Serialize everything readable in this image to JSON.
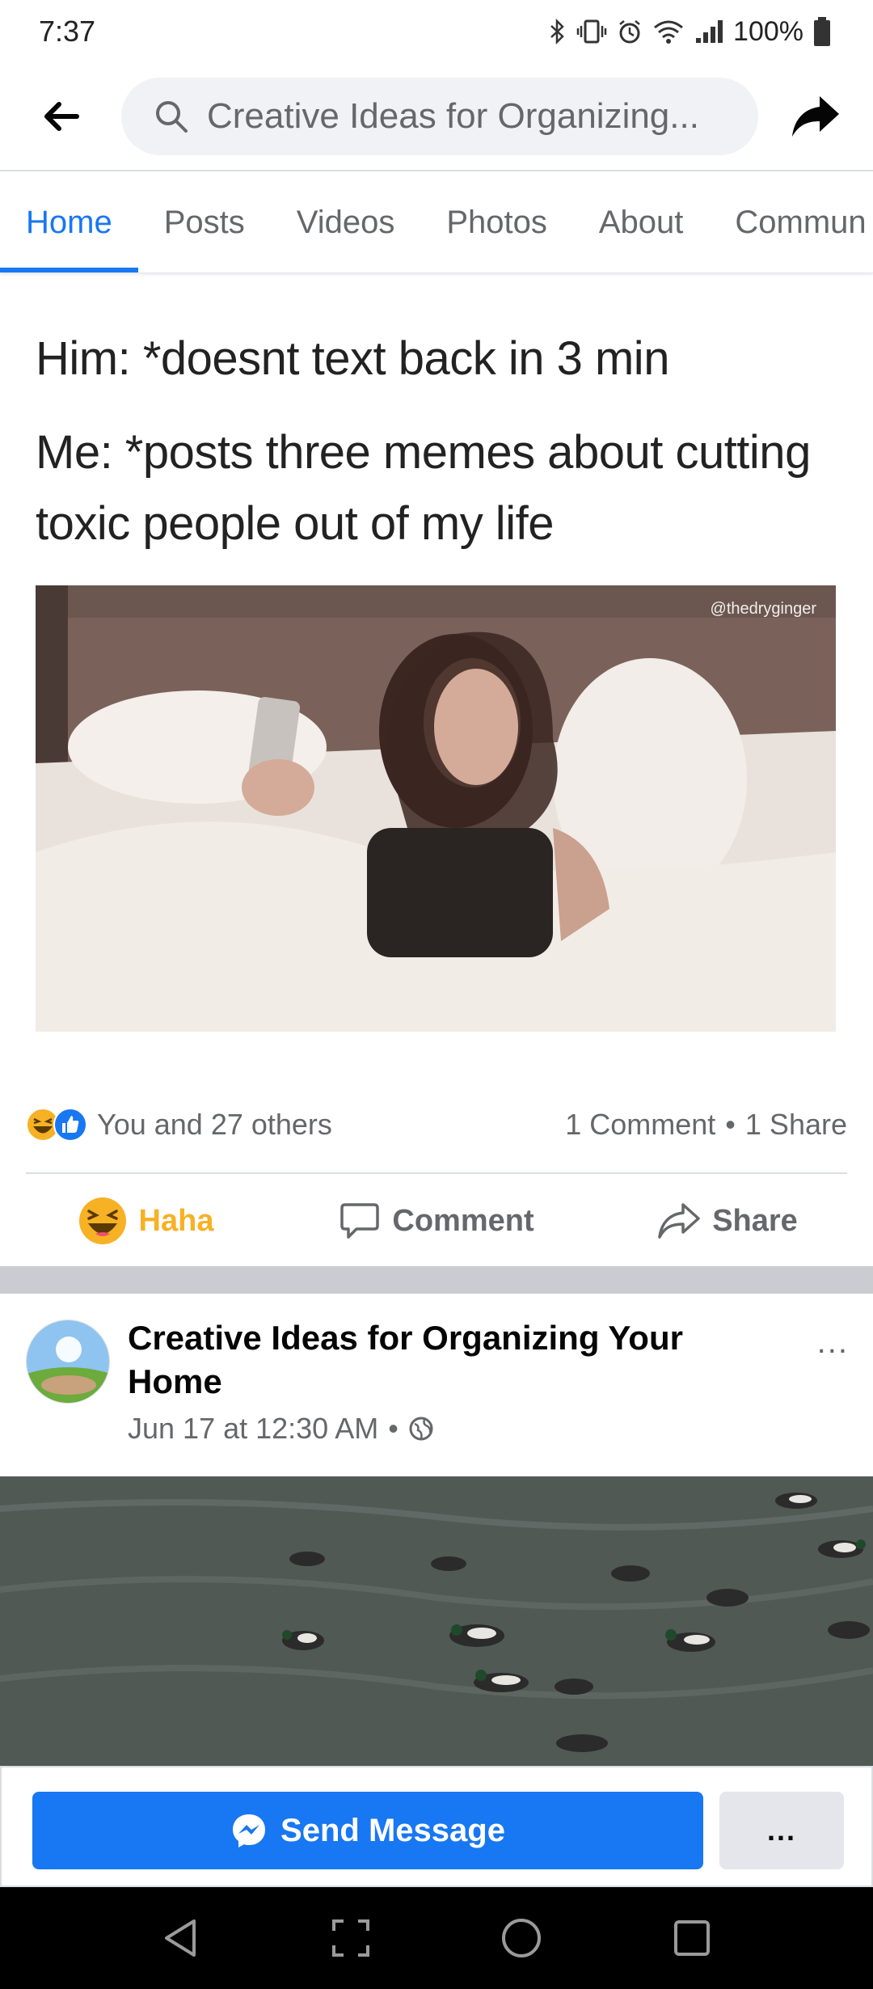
{
  "status_bar": {
    "time": "7:37",
    "battery": "100%"
  },
  "header": {
    "search_text": "Creative Ideas for Organizing..."
  },
  "tabs": [
    {
      "label": "Home",
      "active": true
    },
    {
      "label": "Posts",
      "active": false
    },
    {
      "label": "Videos",
      "active": false
    },
    {
      "label": "Photos",
      "active": false
    },
    {
      "label": "About",
      "active": false
    },
    {
      "label": "Commun",
      "active": false
    }
  ],
  "meme": {
    "line1": "Him: *doesnt text back in 3 min",
    "line2": "Me: *posts three memes about cutting",
    "line3": "toxic people out of my life",
    "watermark": "@thedryginger"
  },
  "reactions": {
    "summary": "You and 27 others",
    "comments": "1 Comment",
    "separator": "•",
    "shares": "1 Share"
  },
  "actions": {
    "haha": "Haha",
    "comment": "Comment",
    "share": "Share"
  },
  "post": {
    "page_name": "Creative Ideas for Organizing Your Home",
    "timestamp": "Jun 17 at 12:30 AM",
    "separator": "•",
    "more": "..."
  },
  "bottom_bar": {
    "send_message": "Send Message",
    "more": "..."
  },
  "colors": {
    "facebook_blue": "#1877f2",
    "haha_yellow": "#f7b125",
    "secondary_text": "#65676b"
  },
  "icons": [
    "back-arrow-icon",
    "search-icon",
    "share-arrow-icon",
    "haha-emoji-icon",
    "like-icon",
    "comment-icon",
    "share-icon",
    "globe-icon",
    "messenger-icon",
    "nav-back-icon",
    "nav-recents-icon",
    "nav-home-icon",
    "nav-overview-icon"
  ]
}
